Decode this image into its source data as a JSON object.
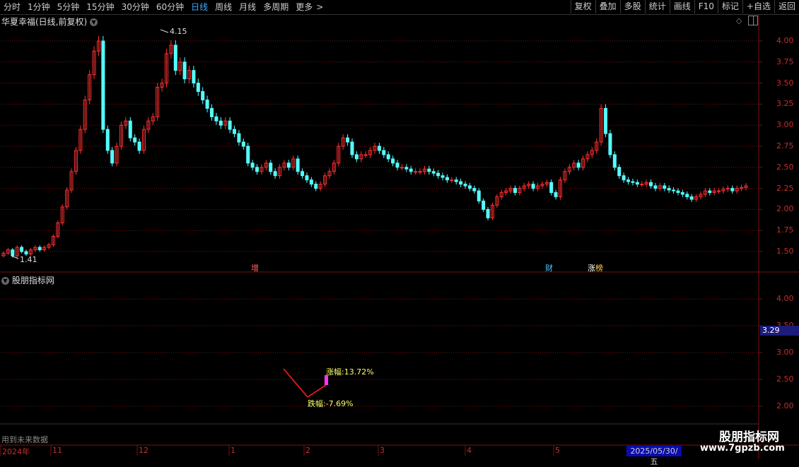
{
  "toolbar": {
    "periods": [
      "分时",
      "1分钟",
      "5分钟",
      "15分钟",
      "30分钟",
      "60分钟",
      "日线",
      "周线",
      "月线",
      "多周期",
      "更多"
    ],
    "active_period": "日线",
    "more_arrow": ">",
    "right_buttons": [
      "复权",
      "叠加",
      "多股",
      "统计",
      "画线",
      "F10",
      "标记",
      "+自选",
      "返回"
    ]
  },
  "main_chart": {
    "title": "华夏幸福(日线,前复权)",
    "y_ticks": [
      "4.00",
      "3.75",
      "3.50",
      "3.25",
      "3.00",
      "2.75",
      "2.50",
      "2.25",
      "2.00",
      "1.75",
      "1.50"
    ],
    "high_label": "4.15",
    "low_label": "1.41",
    "markers": [
      {
        "text": "增",
        "color": "#ff6060"
      },
      {
        "text": "财",
        "color": "#4fc8ff"
      },
      {
        "text": "涨",
        "color": "#ffffff"
      },
      {
        "text": "榜",
        "color": "#ffd24d"
      }
    ]
  },
  "indicator": {
    "title": "股朋指标网",
    "y_ticks": [
      "4.00",
      "3.50",
      "3.00",
      "2.50",
      "2.00"
    ],
    "current_value": "3.29",
    "rise_label": "涨幅:13.72%",
    "fall_label": "跌幅:-7.69%",
    "footer_note": "用到未来数据"
  },
  "x_axis": {
    "labels": [
      "2024年",
      "11",
      "12",
      "1",
      "2",
      "3",
      "4",
      "5"
    ],
    "current_date": "2025/05/30/五"
  },
  "watermark": {
    "name": "股朋指标网",
    "url": "www.7gpzb.com"
  },
  "colors": {
    "up": "#ff3030",
    "down": "#54ffff",
    "active": "#3fa9ff",
    "grid": "#7a1212"
  },
  "chart_data": {
    "type": "candlestick",
    "ylim": [
      1.35,
      4.2
    ],
    "close": [
      1.48,
      1.52,
      1.45,
      1.55,
      1.5,
      1.47,
      1.52,
      1.55,
      1.52,
      1.55,
      1.58,
      1.68,
      1.84,
      2.03,
      2.23,
      2.45,
      2.7,
      2.95,
      3.3,
      3.6,
      3.88,
      4.0,
      2.95,
      2.7,
      2.55,
      2.75,
      3.0,
      3.05,
      2.85,
      2.8,
      2.7,
      2.95,
      3.05,
      3.1,
      3.45,
      3.5,
      3.85,
      3.95,
      3.65,
      3.75,
      3.55,
      3.65,
      3.5,
      3.4,
      3.3,
      3.2,
      3.1,
      3.05,
      3.0,
      3.05,
      2.95,
      2.9,
      2.8,
      2.75,
      2.55,
      2.5,
      2.45,
      2.5,
      2.55,
      2.45,
      2.4,
      2.5,
      2.55,
      2.5,
      2.6,
      2.45,
      2.4,
      2.35,
      2.3,
      2.25,
      2.3,
      2.4,
      2.45,
      2.55,
      2.75,
      2.85,
      2.8,
      2.65,
      2.6,
      2.65,
      2.65,
      2.7,
      2.75,
      2.7,
      2.65,
      2.6,
      2.55,
      2.5,
      2.5,
      2.48,
      2.45,
      2.45,
      2.45,
      2.48,
      2.45,
      2.43,
      2.4,
      2.38,
      2.35,
      2.35,
      2.33,
      2.3,
      2.28,
      2.25,
      2.22,
      2.1,
      2.0,
      1.9,
      2.05,
      2.15,
      2.2,
      2.22,
      2.25,
      2.2,
      2.25,
      2.28,
      2.3,
      2.25,
      2.28,
      2.3,
      2.32,
      2.2,
      2.15,
      2.35,
      2.45,
      2.5,
      2.55,
      2.5,
      2.6,
      2.65,
      2.7,
      2.8,
      3.2,
      2.9,
      2.65,
      2.5,
      2.4,
      2.35,
      2.33,
      2.32,
      2.3,
      2.3,
      2.32,
      2.28,
      2.25,
      2.28,
      2.25,
      2.23,
      2.22,
      2.2,
      2.18,
      2.15,
      2.12,
      2.15,
      2.18,
      2.22,
      2.2,
      2.22,
      2.22,
      2.24,
      2.25,
      2.22,
      2.25,
      2.26,
      2.28
    ]
  }
}
